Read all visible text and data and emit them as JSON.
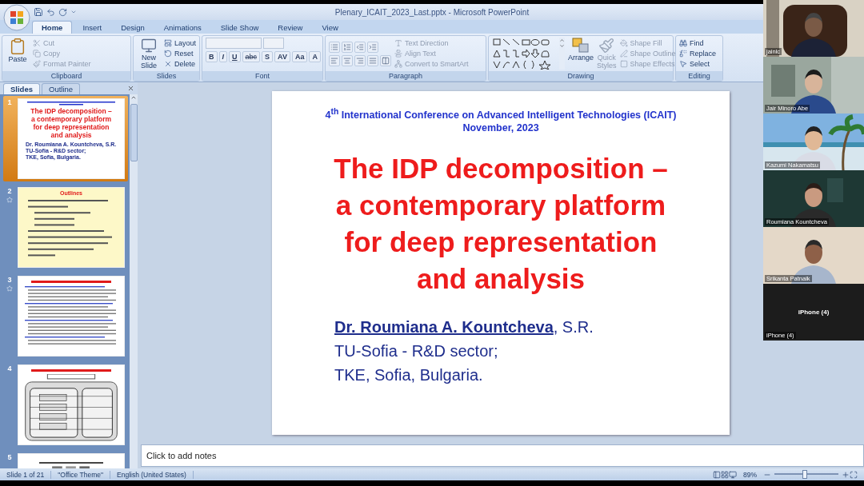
{
  "window": {
    "title": "Plenary_ICAIT_2023_Last.pptx - Microsoft PowerPoint"
  },
  "ribbon_tabs": [
    {
      "label": "Home",
      "selected": true
    },
    {
      "label": "Insert",
      "selected": false
    },
    {
      "label": "Design",
      "selected": false
    },
    {
      "label": "Animations",
      "selected": false
    },
    {
      "label": "Slide Show",
      "selected": false
    },
    {
      "label": "Review",
      "selected": false
    },
    {
      "label": "View",
      "selected": false
    }
  ],
  "clipboard": {
    "label": "Clipboard",
    "paste": "Paste",
    "items": [
      {
        "label": "Cut",
        "disabled": true
      },
      {
        "label": "Copy",
        "disabled": true
      },
      {
        "label": "Format Painter",
        "disabled": true
      }
    ]
  },
  "slides_group": {
    "label": "Slides",
    "new_slide": "New Slide",
    "items": [
      {
        "label": "Layout",
        "disabled": false
      },
      {
        "label": "Reset",
        "disabled": false
      },
      {
        "label": "Delete",
        "disabled": false
      }
    ]
  },
  "font_group": {
    "label": "Font",
    "buttons": [
      "B",
      "I",
      "U",
      "abc",
      "S",
      "AV",
      "Aa",
      "A"
    ]
  },
  "paragraph_group": {
    "label": "Paragraph",
    "items": [
      {
        "label": "Text Direction",
        "disabled": true
      },
      {
        "label": "Align Text",
        "disabled": true
      },
      {
        "label": "Convert to SmartArt",
        "disabled": true
      }
    ]
  },
  "drawing_group": {
    "label": "Drawing",
    "arrange": "Arrange",
    "quick_styles": {
      "label": "Quick Styles",
      "disabled": true
    },
    "items": [
      {
        "label": "Shape Fill",
        "disabled": true
      },
      {
        "label": "Shape Outline",
        "disabled": true
      },
      {
        "label": "Shape Effects",
        "disabled": true
      }
    ]
  },
  "editing_group": {
    "label": "Editing",
    "items": [
      {
        "label": "Find",
        "disabled": false
      },
      {
        "label": "Replace",
        "disabled": false
      },
      {
        "label": "Select",
        "disabled": false
      }
    ]
  },
  "panel_tabs": [
    {
      "label": "Slides",
      "selected": true
    },
    {
      "label": "Outline",
      "selected": false
    }
  ],
  "thumbnails": [
    {
      "number": "1",
      "selected": true,
      "animated": false,
      "kind": "title",
      "title": [
        "The IDP decomposition –",
        "a contemporary  platform",
        "for deep  representation",
        "and analysis"
      ],
      "authors": [
        "Dr. Roumiana A. Kountcheva, S.R.",
        "TU-Sofia - R&D sector;",
        "TKE, Sofia, Bulgaria."
      ]
    },
    {
      "number": "2",
      "selected": false,
      "animated": true,
      "kind": "list",
      "heading": "Outlines"
    },
    {
      "number": "3",
      "selected": false,
      "animated": true,
      "kind": "text"
    },
    {
      "number": "4",
      "selected": false,
      "animated": false,
      "kind": "diagram"
    },
    {
      "number": "5",
      "selected": false,
      "animated": false,
      "kind": "images"
    }
  ],
  "slide": {
    "header": [
      "4$^{th}$ International Conference on Advanced Intelligent Technologies (ICAIT)",
      "November, 2023"
    ],
    "title": [
      "The IDP decomposition –",
      "a contemporary platform",
      "for deep representation",
      "and analysis"
    ],
    "authors": [
      "**Dr. Roumiana A. Kountcheva**, S.R.",
      "TU-Sofia - R&D sector;",
      "TKE, Sofia,  Bulgaria."
    ]
  },
  "notes": {
    "placeholder": "Click to add notes"
  },
  "status_bar": {
    "slide": "Slide 1 of 21",
    "theme": "\"Office Theme\"",
    "language": "English (United States)",
    "zoom": "89%",
    "zoom_slider": {
      "level": 0.47
    }
  },
  "participants": [
    {
      "name": "jainlc",
      "kind": "video"
    },
    {
      "name": "Jair Minoro Abe",
      "kind": "video"
    },
    {
      "name": "Kazumi Nakamatsu",
      "kind": "video"
    },
    {
      "name": "Roumiana Kountcheva",
      "kind": "video"
    },
    {
      "name": "Srikanta Patnaik",
      "kind": "video"
    },
    {
      "name": "iPhone (4)",
      "kind": "audio",
      "label": "iPhone (4)"
    }
  ]
}
